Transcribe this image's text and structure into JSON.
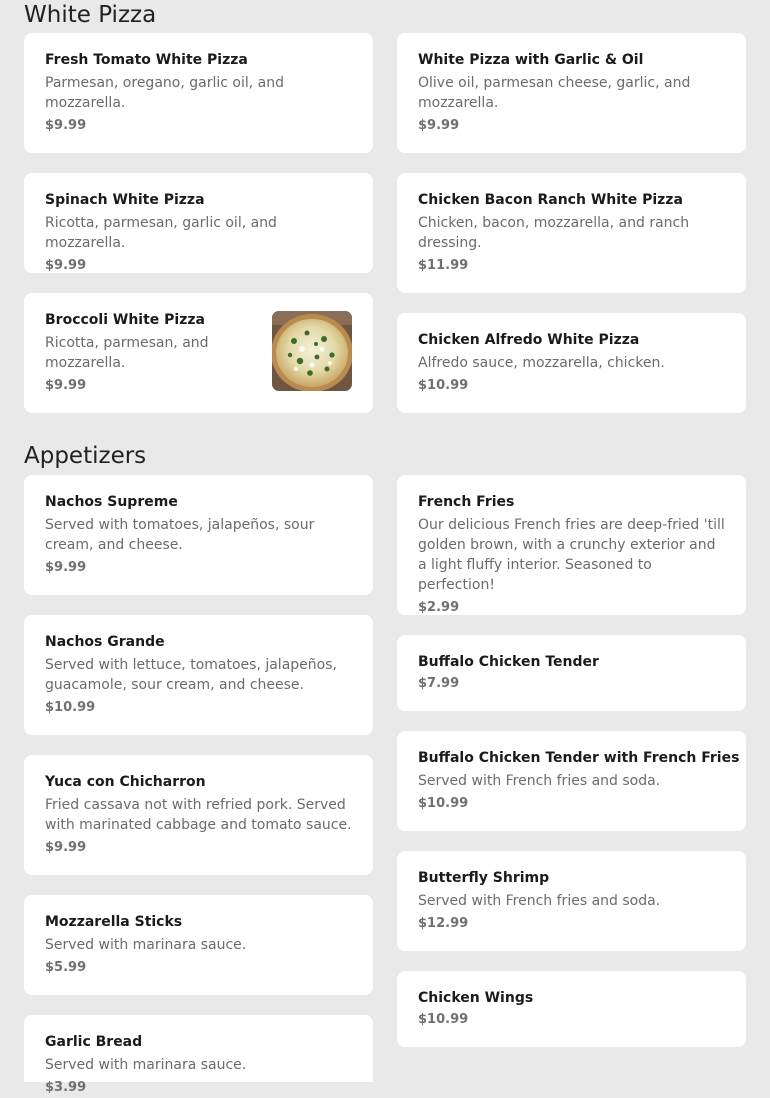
{
  "sections": [
    {
      "title": "White Pizza",
      "items": [
        {
          "name": "Fresh Tomato White Pizza",
          "desc": "Parmesan, oregano, garlic oil, and mozzarella.",
          "price": "$9.99"
        },
        {
          "name": "White Pizza with Garlic & Oil",
          "desc": "Olive oil, parmesan cheese, garlic, and mozzarella.",
          "price": "$9.99"
        },
        {
          "name": "Spinach White Pizza",
          "desc": "Ricotta, parmesan, garlic oil, and mozzarella.",
          "price": "$9.99"
        },
        {
          "name": "Chicken Bacon Ranch White Pizza",
          "desc": "Chicken, bacon, mozzarella, and ranch dressing.",
          "price": "$11.99"
        },
        {
          "name": "Broccoli White Pizza",
          "desc": "Ricotta, parmesan, and mozzarella.",
          "price": "$9.99"
        },
        {
          "name": "Chicken Alfredo White Pizza",
          "desc": "Alfredo sauce, mozzarella, chicken.",
          "price": "$10.99"
        }
      ]
    },
    {
      "title": "Appetizers",
      "items": [
        {
          "name": "Nachos Supreme",
          "desc": "Served with tomatoes, jalapeños, sour cream, and cheese.",
          "price": "$9.99"
        },
        {
          "name": "French Fries",
          "desc": "Our delicious French fries are deep-fried 'till golden brown, with a crunchy exterior and a light fluffy interior. Seasoned to perfection!",
          "price": "$2.99"
        },
        {
          "name": "Nachos Grande",
          "desc": "Served with lettuce, tomatoes, jalapeños, guacamole, sour cream, and cheese.",
          "price": "$10.99"
        },
        {
          "name": "Buffalo Chicken Tender",
          "price": "$7.99"
        },
        {
          "name": "Yuca con Chicharron",
          "desc": "Fried cassava not with refried pork. Served with marinated cabbage and tomato sauce.",
          "price": "$9.99"
        },
        {
          "name": "Buffalo Chicken Tender with French Fries",
          "desc": "Served with French fries and soda.",
          "price": "$10.99"
        },
        {
          "name": "Butterfly Shrimp",
          "desc": "Served with French fries and soda.",
          "price": "$12.99"
        },
        {
          "name": "Mozzarella Sticks",
          "desc": "Served with marinara sauce.",
          "price": "$5.99"
        },
        {
          "name": "Chicken Wings",
          "price": "$10.99"
        },
        {
          "name": "Garlic Bread",
          "desc": "Served with marinara sauce.",
          "price": "$3.99"
        }
      ]
    }
  ],
  "icons": {
    "broccoli_pizza_image": "pizza-photo"
  }
}
